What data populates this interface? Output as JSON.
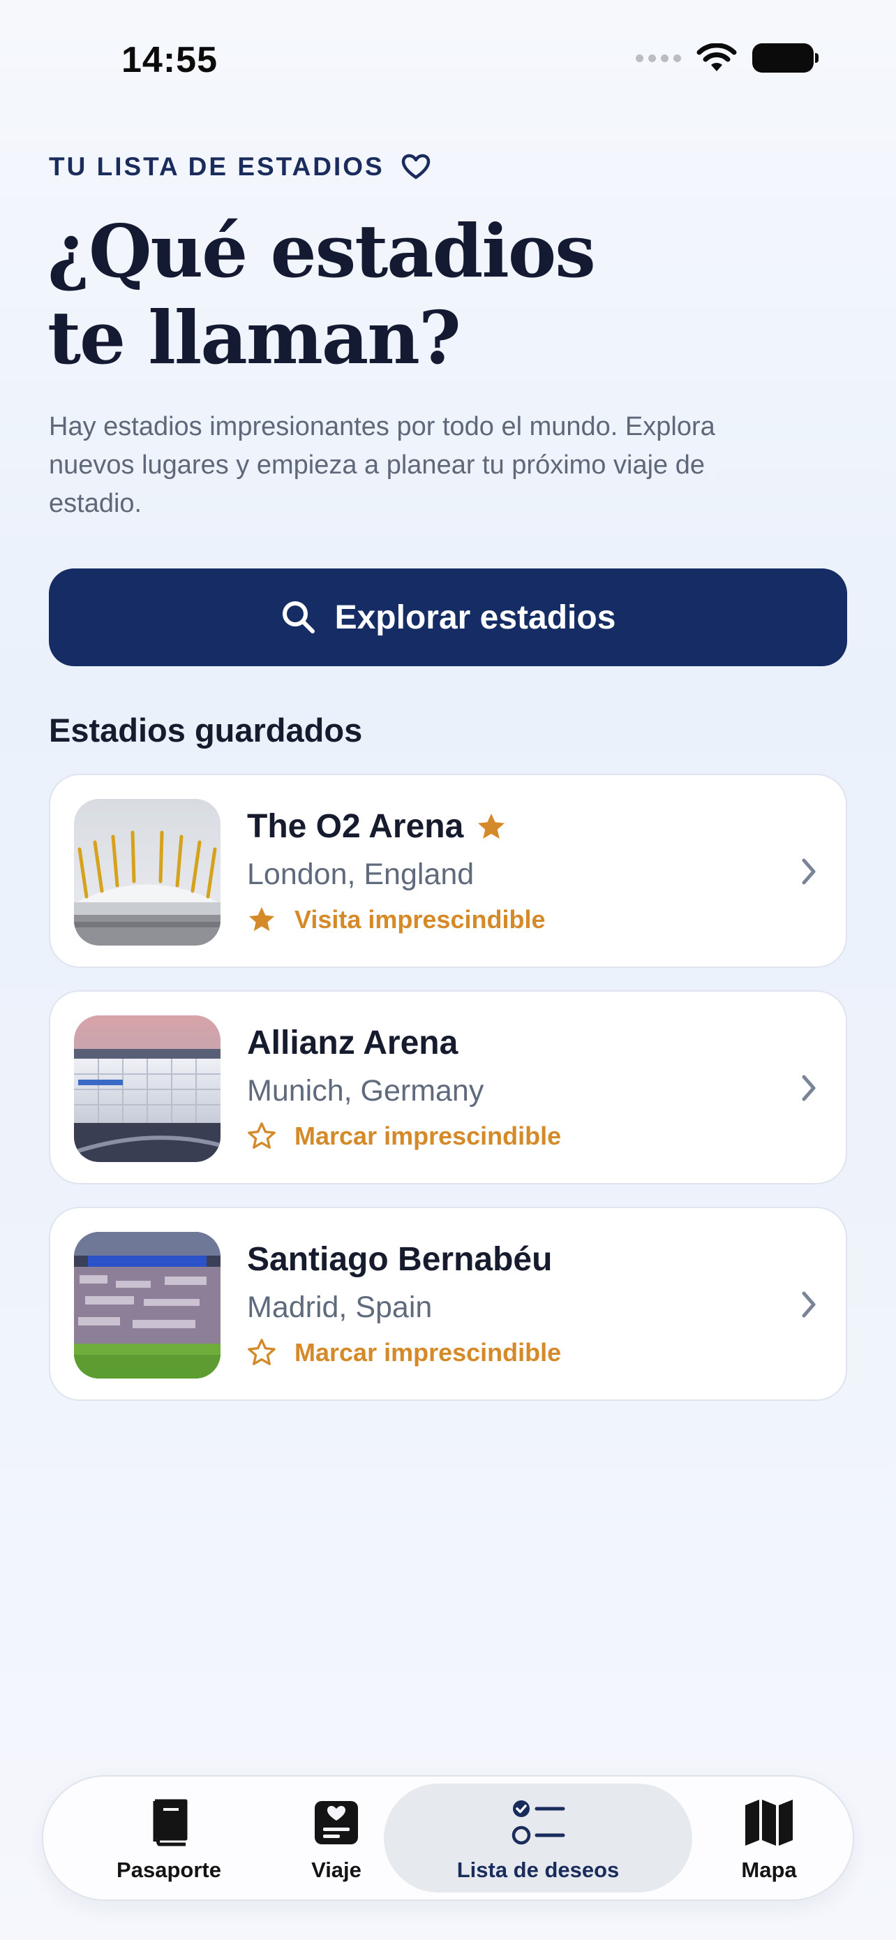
{
  "status_bar": {
    "time": "14:55"
  },
  "header": {
    "eyebrow": "TU LISTA DE ESTADIOS",
    "title_line1": "¿Qué estadios",
    "title_line2": "te llaman?",
    "intro": "Hay estadios impresionantes por todo el mundo. Explora nuevos lugares y empieza a planear tu próximo viaje de estadio."
  },
  "explore_button": {
    "label": "Explorar estadios"
  },
  "saved": {
    "title": "Estadios guardados",
    "items": [
      {
        "name": "The O2 Arena",
        "location": "London, England",
        "tag": "Visita imprescindible",
        "must_visit": true
      },
      {
        "name": "Allianz Arena",
        "location": "Munich, Germany",
        "tag": "Marcar imprescindible",
        "must_visit": false
      },
      {
        "name": "Santiago Bernabéu",
        "location": "Madrid, Spain",
        "tag": "Marcar imprescindible",
        "must_visit": false
      }
    ]
  },
  "tabbar": {
    "tabs": [
      {
        "label": "Pasaporte",
        "icon": "book-icon",
        "active": false
      },
      {
        "label": "Viaje",
        "icon": "ticket-icon",
        "active": false
      },
      {
        "label": "Lista de deseos",
        "icon": "checklist-icon",
        "active": true
      },
      {
        "label": "Mapa",
        "icon": "map-icon",
        "active": false
      }
    ]
  },
  "colors": {
    "primary": "#152d64",
    "accent": "#d58a2a",
    "text": "#141a2e",
    "muted": "#5e6878"
  }
}
